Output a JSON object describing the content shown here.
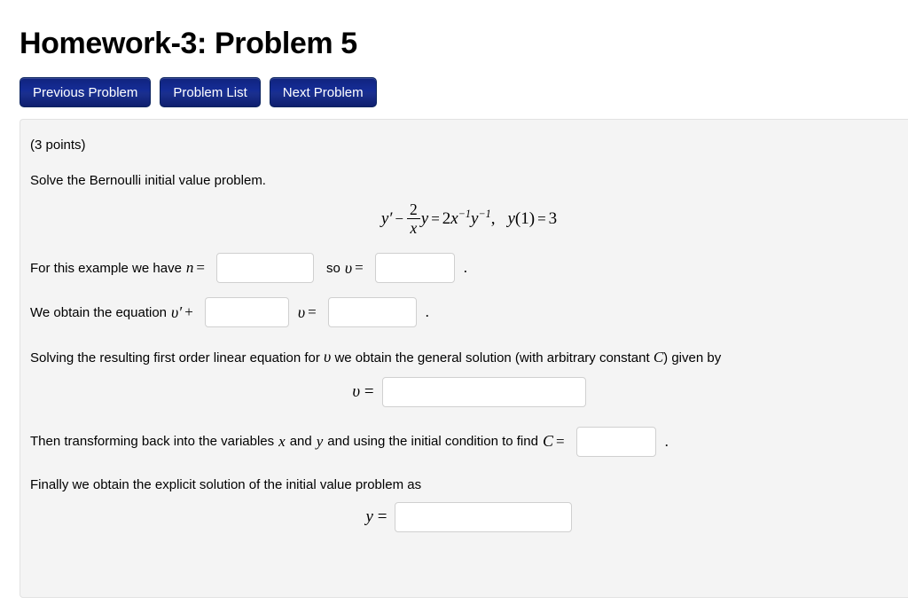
{
  "header": {
    "title": "Homework-3: Problem 5"
  },
  "nav_buttons": [
    {
      "label": "Previous Problem",
      "name": "previous-problem-button"
    },
    {
      "label": "Problem List",
      "name": "problem-list-button"
    },
    {
      "label": "Next Problem",
      "name": "next-problem-button"
    }
  ],
  "problem": {
    "points": "(3 points)",
    "instruction": "Solve the Bernoulli initial value problem.",
    "equation": {
      "lhs_y_prime": "y′",
      "minus": "−",
      "frac_num": "2",
      "frac_den": "x",
      "frac_var": "y",
      "equals": "=",
      "rhs_coeff": "2",
      "rhs_x": "x",
      "rhs_x_exp": "−1",
      "rhs_y": "y",
      "rhs_y_exp": "−1",
      "comma": ",",
      "ic_y": "y",
      "ic_open": "(",
      "ic_arg": "1",
      "ic_close": ")",
      "ic_equals": "=",
      "ic_value": "3",
      "plain": "y′ − (2/x)y = 2x⁻¹y⁻¹,  y(1) = 3"
    },
    "line_n": {
      "text_before": "For this example we have",
      "symbol_n": "n",
      "equals1": "=",
      "text_middle": "so",
      "symbol_v": "υ",
      "equals2": "=",
      "period": ".",
      "input_n_value": "",
      "input_v_value": ""
    },
    "line_equation": {
      "text_before": "We obtain the equation",
      "symbol_vprime": "υ′",
      "plus": "+",
      "symbol_v": "υ",
      "equals": "=",
      "period": ".",
      "input_coeff_value": "",
      "input_rhs_value": ""
    },
    "line_solving": "Solving the resulting first order linear equation for υ we obtain the general solution (with arbitrary constant C) given by",
    "line_solving_parts": {
      "p1": "Solving the resulting first order linear equation for",
      "v": "υ",
      "p2": "we obtain the general solution (with arbitrary constant",
      "c": "C",
      "p3": ") given by"
    },
    "general_solution": {
      "symbol_v": "υ",
      "equals": "=",
      "input_value": ""
    },
    "line_transform": {
      "p1": "Then transforming back into the variables",
      "x": "x",
      "p2": "and",
      "y": "y",
      "p3": "and using the initial condition to find",
      "c": "C",
      "equals": "=",
      "period": ".",
      "input_value": ""
    },
    "line_final": "Finally we obtain the explicit solution of the initial value problem as",
    "explicit_solution": {
      "symbol_y": "y",
      "equals": "=",
      "input_value": ""
    }
  }
}
